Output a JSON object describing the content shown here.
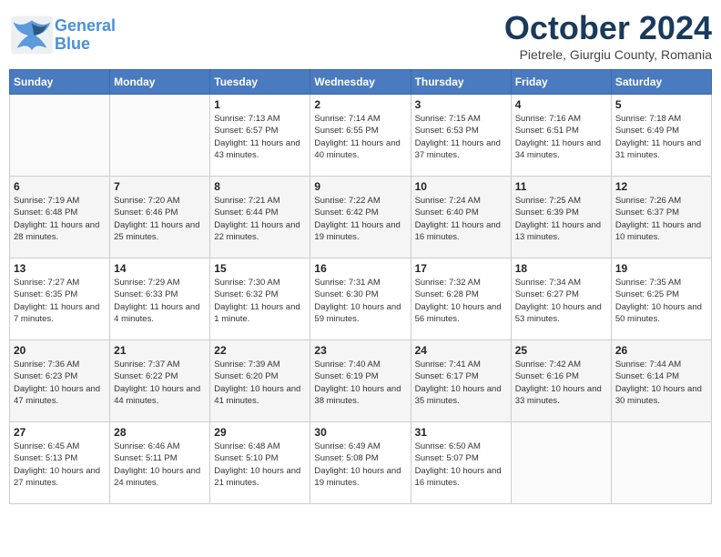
{
  "header": {
    "logo_line1": "General",
    "logo_line2": "Blue",
    "month": "October 2024",
    "location": "Pietrele, Giurgiu County, Romania"
  },
  "days_of_week": [
    "Sunday",
    "Monday",
    "Tuesday",
    "Wednesday",
    "Thursday",
    "Friday",
    "Saturday"
  ],
  "weeks": [
    [
      {
        "day": "",
        "sunrise": "",
        "sunset": "",
        "daylight": ""
      },
      {
        "day": "",
        "sunrise": "",
        "sunset": "",
        "daylight": ""
      },
      {
        "day": "1",
        "sunrise": "Sunrise: 7:13 AM",
        "sunset": "Sunset: 6:57 PM",
        "daylight": "Daylight: 11 hours and 43 minutes."
      },
      {
        "day": "2",
        "sunrise": "Sunrise: 7:14 AM",
        "sunset": "Sunset: 6:55 PM",
        "daylight": "Daylight: 11 hours and 40 minutes."
      },
      {
        "day": "3",
        "sunrise": "Sunrise: 7:15 AM",
        "sunset": "Sunset: 6:53 PM",
        "daylight": "Daylight: 11 hours and 37 minutes."
      },
      {
        "day": "4",
        "sunrise": "Sunrise: 7:16 AM",
        "sunset": "Sunset: 6:51 PM",
        "daylight": "Daylight: 11 hours and 34 minutes."
      },
      {
        "day": "5",
        "sunrise": "Sunrise: 7:18 AM",
        "sunset": "Sunset: 6:49 PM",
        "daylight": "Daylight: 11 hours and 31 minutes."
      }
    ],
    [
      {
        "day": "6",
        "sunrise": "Sunrise: 7:19 AM",
        "sunset": "Sunset: 6:48 PM",
        "daylight": "Daylight: 11 hours and 28 minutes."
      },
      {
        "day": "7",
        "sunrise": "Sunrise: 7:20 AM",
        "sunset": "Sunset: 6:46 PM",
        "daylight": "Daylight: 11 hours and 25 minutes."
      },
      {
        "day": "8",
        "sunrise": "Sunrise: 7:21 AM",
        "sunset": "Sunset: 6:44 PM",
        "daylight": "Daylight: 11 hours and 22 minutes."
      },
      {
        "day": "9",
        "sunrise": "Sunrise: 7:22 AM",
        "sunset": "Sunset: 6:42 PM",
        "daylight": "Daylight: 11 hours and 19 minutes."
      },
      {
        "day": "10",
        "sunrise": "Sunrise: 7:24 AM",
        "sunset": "Sunset: 6:40 PM",
        "daylight": "Daylight: 11 hours and 16 minutes."
      },
      {
        "day": "11",
        "sunrise": "Sunrise: 7:25 AM",
        "sunset": "Sunset: 6:39 PM",
        "daylight": "Daylight: 11 hours and 13 minutes."
      },
      {
        "day": "12",
        "sunrise": "Sunrise: 7:26 AM",
        "sunset": "Sunset: 6:37 PM",
        "daylight": "Daylight: 11 hours and 10 minutes."
      }
    ],
    [
      {
        "day": "13",
        "sunrise": "Sunrise: 7:27 AM",
        "sunset": "Sunset: 6:35 PM",
        "daylight": "Daylight: 11 hours and 7 minutes."
      },
      {
        "day": "14",
        "sunrise": "Sunrise: 7:29 AM",
        "sunset": "Sunset: 6:33 PM",
        "daylight": "Daylight: 11 hours and 4 minutes."
      },
      {
        "day": "15",
        "sunrise": "Sunrise: 7:30 AM",
        "sunset": "Sunset: 6:32 PM",
        "daylight": "Daylight: 11 hours and 1 minute."
      },
      {
        "day": "16",
        "sunrise": "Sunrise: 7:31 AM",
        "sunset": "Sunset: 6:30 PM",
        "daylight": "Daylight: 10 hours and 59 minutes."
      },
      {
        "day": "17",
        "sunrise": "Sunrise: 7:32 AM",
        "sunset": "Sunset: 6:28 PM",
        "daylight": "Daylight: 10 hours and 56 minutes."
      },
      {
        "day": "18",
        "sunrise": "Sunrise: 7:34 AM",
        "sunset": "Sunset: 6:27 PM",
        "daylight": "Daylight: 10 hours and 53 minutes."
      },
      {
        "day": "19",
        "sunrise": "Sunrise: 7:35 AM",
        "sunset": "Sunset: 6:25 PM",
        "daylight": "Daylight: 10 hours and 50 minutes."
      }
    ],
    [
      {
        "day": "20",
        "sunrise": "Sunrise: 7:36 AM",
        "sunset": "Sunset: 6:23 PM",
        "daylight": "Daylight: 10 hours and 47 minutes."
      },
      {
        "day": "21",
        "sunrise": "Sunrise: 7:37 AM",
        "sunset": "Sunset: 6:22 PM",
        "daylight": "Daylight: 10 hours and 44 minutes."
      },
      {
        "day": "22",
        "sunrise": "Sunrise: 7:39 AM",
        "sunset": "Sunset: 6:20 PM",
        "daylight": "Daylight: 10 hours and 41 minutes."
      },
      {
        "day": "23",
        "sunrise": "Sunrise: 7:40 AM",
        "sunset": "Sunset: 6:19 PM",
        "daylight": "Daylight: 10 hours and 38 minutes."
      },
      {
        "day": "24",
        "sunrise": "Sunrise: 7:41 AM",
        "sunset": "Sunset: 6:17 PM",
        "daylight": "Daylight: 10 hours and 35 minutes."
      },
      {
        "day": "25",
        "sunrise": "Sunrise: 7:42 AM",
        "sunset": "Sunset: 6:16 PM",
        "daylight": "Daylight: 10 hours and 33 minutes."
      },
      {
        "day": "26",
        "sunrise": "Sunrise: 7:44 AM",
        "sunset": "Sunset: 6:14 PM",
        "daylight": "Daylight: 10 hours and 30 minutes."
      }
    ],
    [
      {
        "day": "27",
        "sunrise": "Sunrise: 6:45 AM",
        "sunset": "Sunset: 5:13 PM",
        "daylight": "Daylight: 10 hours and 27 minutes."
      },
      {
        "day": "28",
        "sunrise": "Sunrise: 6:46 AM",
        "sunset": "Sunset: 5:11 PM",
        "daylight": "Daylight: 10 hours and 24 minutes."
      },
      {
        "day": "29",
        "sunrise": "Sunrise: 6:48 AM",
        "sunset": "Sunset: 5:10 PM",
        "daylight": "Daylight: 10 hours and 21 minutes."
      },
      {
        "day": "30",
        "sunrise": "Sunrise: 6:49 AM",
        "sunset": "Sunset: 5:08 PM",
        "daylight": "Daylight: 10 hours and 19 minutes."
      },
      {
        "day": "31",
        "sunrise": "Sunrise: 6:50 AM",
        "sunset": "Sunset: 5:07 PM",
        "daylight": "Daylight: 10 hours and 16 minutes."
      },
      {
        "day": "",
        "sunrise": "",
        "sunset": "",
        "daylight": ""
      },
      {
        "day": "",
        "sunrise": "",
        "sunset": "",
        "daylight": ""
      }
    ]
  ]
}
